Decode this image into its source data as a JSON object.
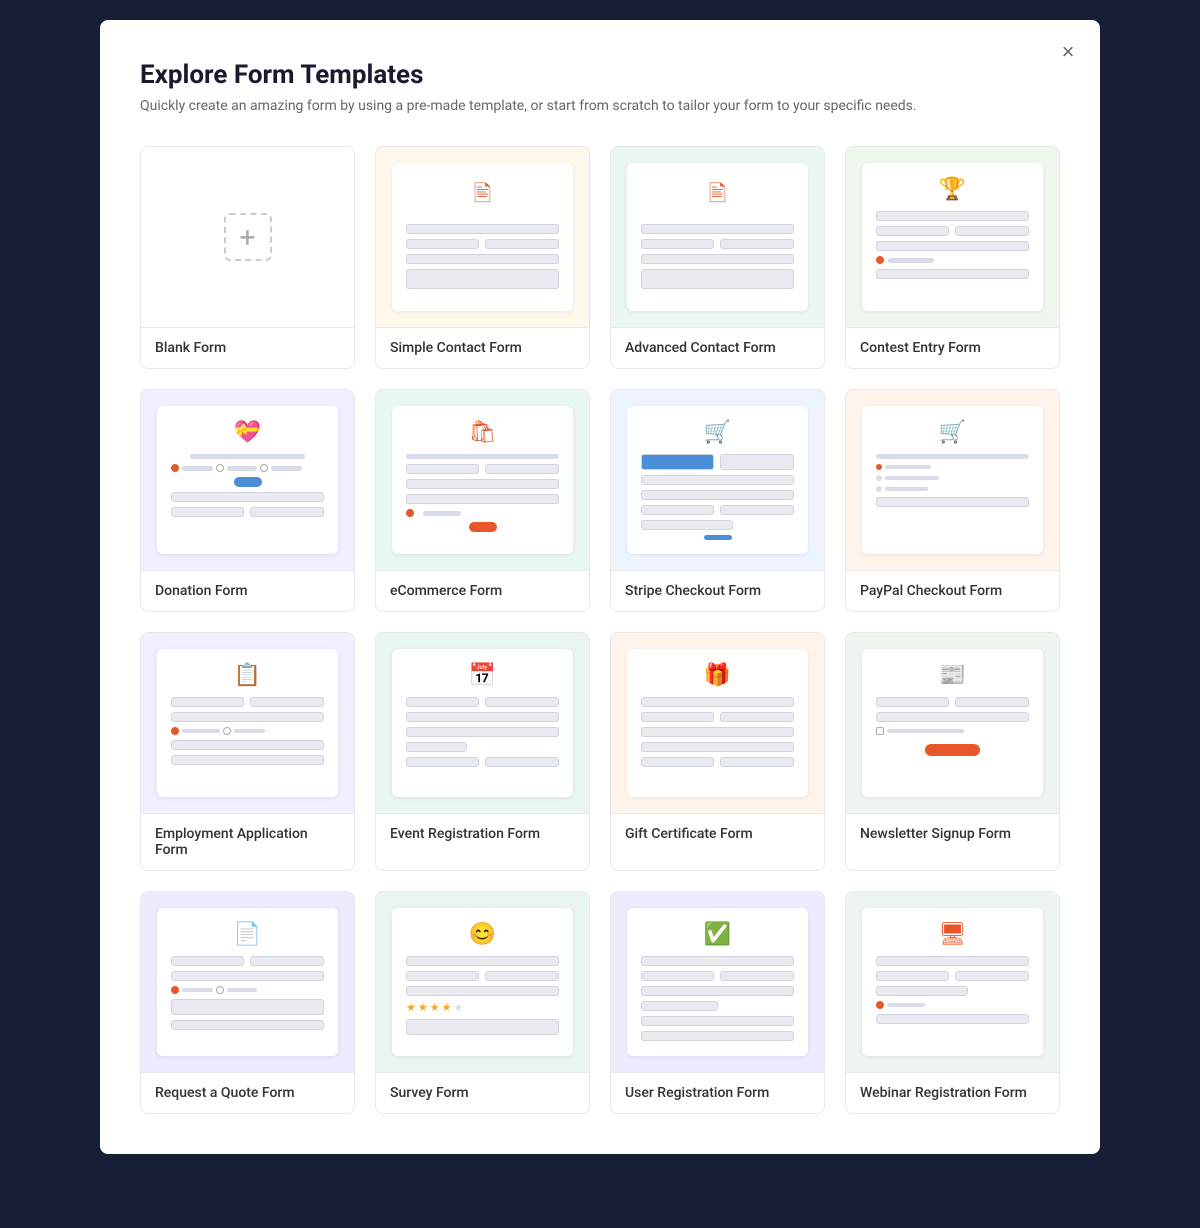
{
  "modal": {
    "title": "Explore Form Templates",
    "subtitle": "Quickly create an amazing form by using a pre-made template, or start from scratch to tailor your form to your specific needs.",
    "close_label": "×"
  },
  "templates": [
    {
      "id": "blank",
      "label": "Blank Form",
      "bg": "bg-white",
      "type": "blank"
    },
    {
      "id": "simple-contact",
      "label": "Simple Contact Form",
      "bg": "bg-yellow",
      "type": "contact-simple"
    },
    {
      "id": "advanced-contact",
      "label": "Advanced Contact Form",
      "bg": "bg-teal",
      "type": "contact-advanced"
    },
    {
      "id": "contest-entry",
      "label": "Contest Entry Form",
      "bg": "bg-green",
      "type": "contest"
    },
    {
      "id": "donation",
      "label": "Donation Form",
      "bg": "bg-lavender",
      "type": "donation"
    },
    {
      "id": "ecommerce",
      "label": "eCommerce Form",
      "bg": "bg-mint",
      "type": "ecommerce"
    },
    {
      "id": "stripe-checkout",
      "label": "Stripe Checkout Form",
      "bg": "bg-blue-light",
      "type": "stripe"
    },
    {
      "id": "paypal-checkout",
      "label": "PayPal Checkout Form",
      "bg": "bg-peach",
      "type": "paypal"
    },
    {
      "id": "employment-application",
      "label": "Employment Application Form",
      "bg": "bg-lavender",
      "type": "employment"
    },
    {
      "id": "event-registration",
      "label": "Event Registration Form",
      "bg": "bg-teal2",
      "type": "event"
    },
    {
      "id": "gift-certificate",
      "label": "Gift Certificate Form",
      "bg": "bg-peach",
      "type": "gift"
    },
    {
      "id": "newsletter-signup",
      "label": "Newsletter Signup Form",
      "bg": "bg-gray-green",
      "type": "newsletter"
    },
    {
      "id": "request-quote",
      "label": "Request a Quote Form",
      "bg": "bg-lavender2",
      "type": "quote"
    },
    {
      "id": "survey",
      "label": "Survey Form",
      "bg": "bg-teal2",
      "type": "survey"
    },
    {
      "id": "user-registration",
      "label": "User Registration Form",
      "bg": "bg-lavender2",
      "type": "user-reg"
    },
    {
      "id": "webinar-registration",
      "label": "Webinar Registration Form",
      "bg": "bg-gray-green",
      "type": "webinar"
    }
  ]
}
